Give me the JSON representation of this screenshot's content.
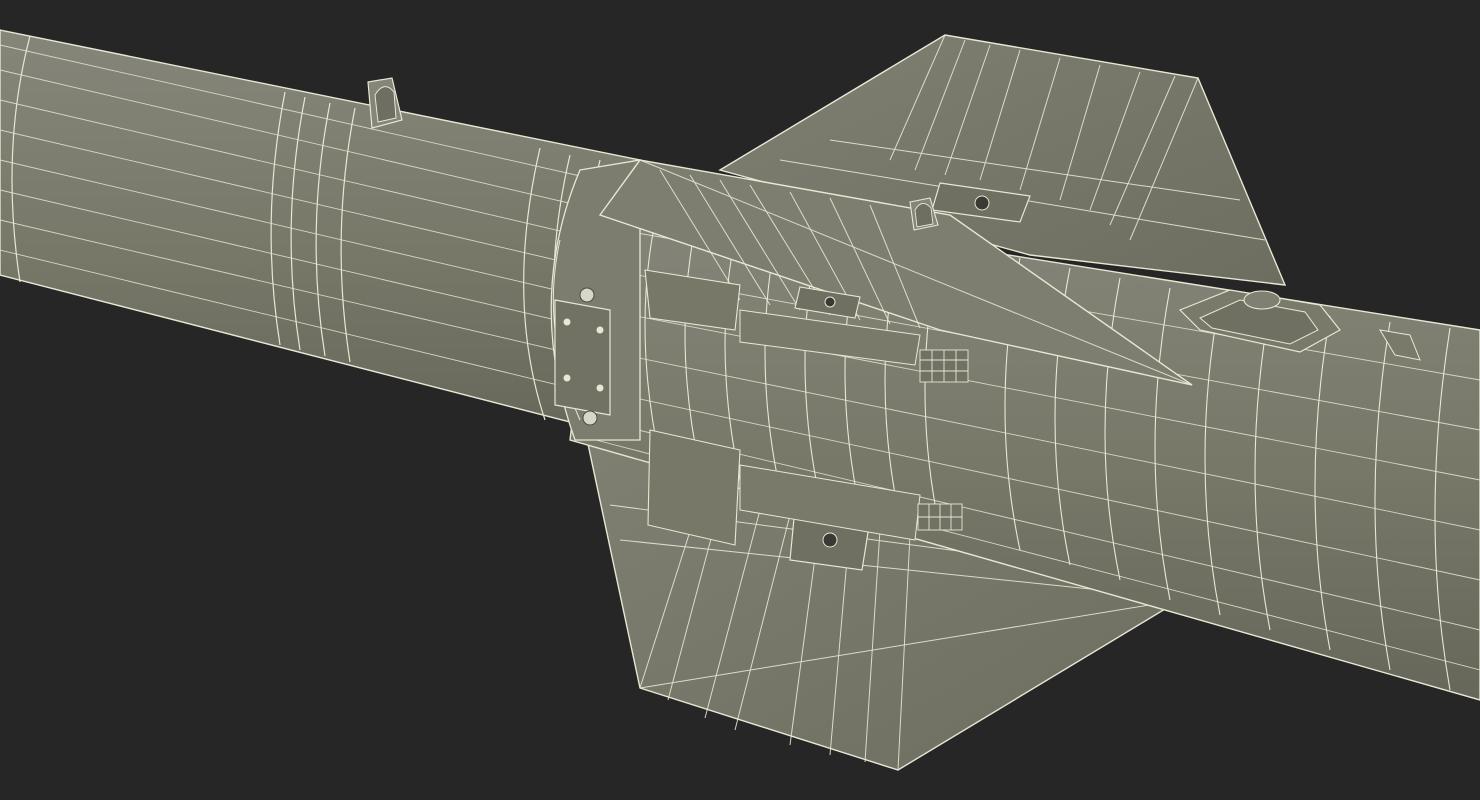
{
  "scene": {
    "subject": "missile-wireframe-render",
    "colors": {
      "background": "#262626",
      "surface": "#7a7a6c",
      "surface_light": "#85857a",
      "surface_dark": "#6a6a5e",
      "wire": "#e8e7d4",
      "bolt": "#d8d6c6"
    },
    "icons": [
      "lug-icon",
      "bolt-icon",
      "fin-icon"
    ]
  }
}
